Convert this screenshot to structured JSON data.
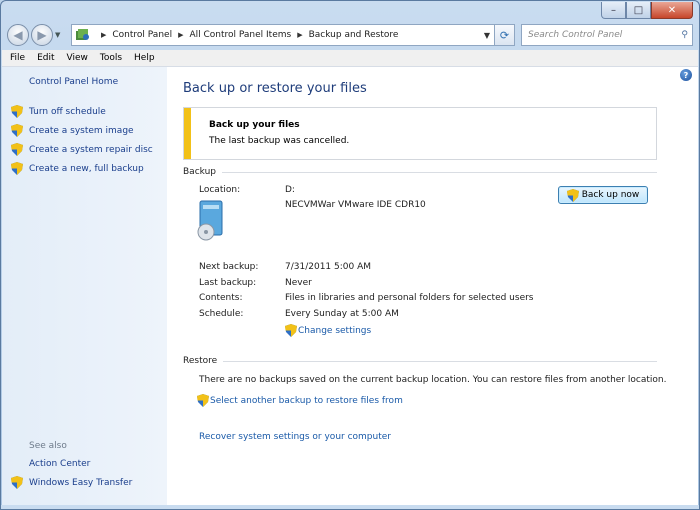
{
  "window": {
    "caption": {
      "min": "–",
      "max": "□",
      "close": "✕"
    }
  },
  "address": {
    "crumbs": [
      "Control Panel",
      "All Control Panel Items",
      "Backup and Restore"
    ],
    "search_placeholder": "Search Control Panel"
  },
  "menu": [
    "File",
    "Edit",
    "View",
    "Tools",
    "Help"
  ],
  "sidebar": {
    "home": "Control Panel Home",
    "items": [
      {
        "label": "Turn off schedule"
      },
      {
        "label": "Create a system image"
      },
      {
        "label": "Create a system repair disc"
      },
      {
        "label": "Create a new, full backup"
      }
    ],
    "see_also_label": "See also",
    "see_also": [
      {
        "label": "Action Center"
      },
      {
        "label": "Windows Easy Transfer"
      }
    ]
  },
  "main": {
    "title": "Back up or restore your files",
    "notice": {
      "heading": "Back up your files",
      "message": "The last backup was cancelled."
    },
    "backup": {
      "section": "Backup",
      "location_label": "Location:",
      "location_value": "D:",
      "device": "NECVMWar VMware IDE CDR10",
      "backup_now": "Back up now",
      "next_label": "Next backup:",
      "next_value": "7/31/2011 5:00 AM",
      "last_label": "Last backup:",
      "last_value": "Never",
      "contents_label": "Contents:",
      "contents_value": "Files in libraries and personal folders for selected users",
      "schedule_label": "Schedule:",
      "schedule_value": "Every Sunday at 5:00 AM",
      "change_settings": "Change settings"
    },
    "restore": {
      "section": "Restore",
      "message": "There are no backups saved on the current backup location. You can restore files from another location.",
      "select_link": "Select another backup to restore files from",
      "recover_link": "Recover system settings or your computer"
    }
  },
  "colors": {
    "link": "#1a5aa8",
    "title": "#1e3c7a",
    "warning_bar": "#f2c118",
    "sidebar_bg": "#e3edf8"
  }
}
